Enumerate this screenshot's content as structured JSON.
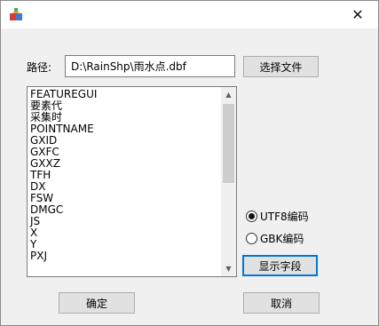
{
  "titlebar": {
    "close_label": "✕"
  },
  "form": {
    "path_label": "路径:",
    "path_value": "D:\\RainShp\\雨水点.dbf",
    "choose_file_label": "选择文件",
    "show_fields_label": "显示字段",
    "ok_label": "确定",
    "cancel_label": "取消"
  },
  "fields": [
    "FEATUREGUI",
    "要素代",
    "采集时",
    "POINTNAME",
    "GXID",
    "GXFC",
    "GXXZ",
    "TFH",
    "DX",
    "FSW",
    "DMGC",
    "JS",
    "X",
    "Y",
    "PXJ"
  ],
  "encoding": {
    "options": [
      {
        "label": "UTF8编码",
        "checked": true
      },
      {
        "label": "GBK编码",
        "checked": false
      }
    ]
  },
  "colors": {
    "window_bg": "#f0f0f0",
    "button_bg": "#e1e1e1",
    "focus_border": "#0078d7"
  }
}
